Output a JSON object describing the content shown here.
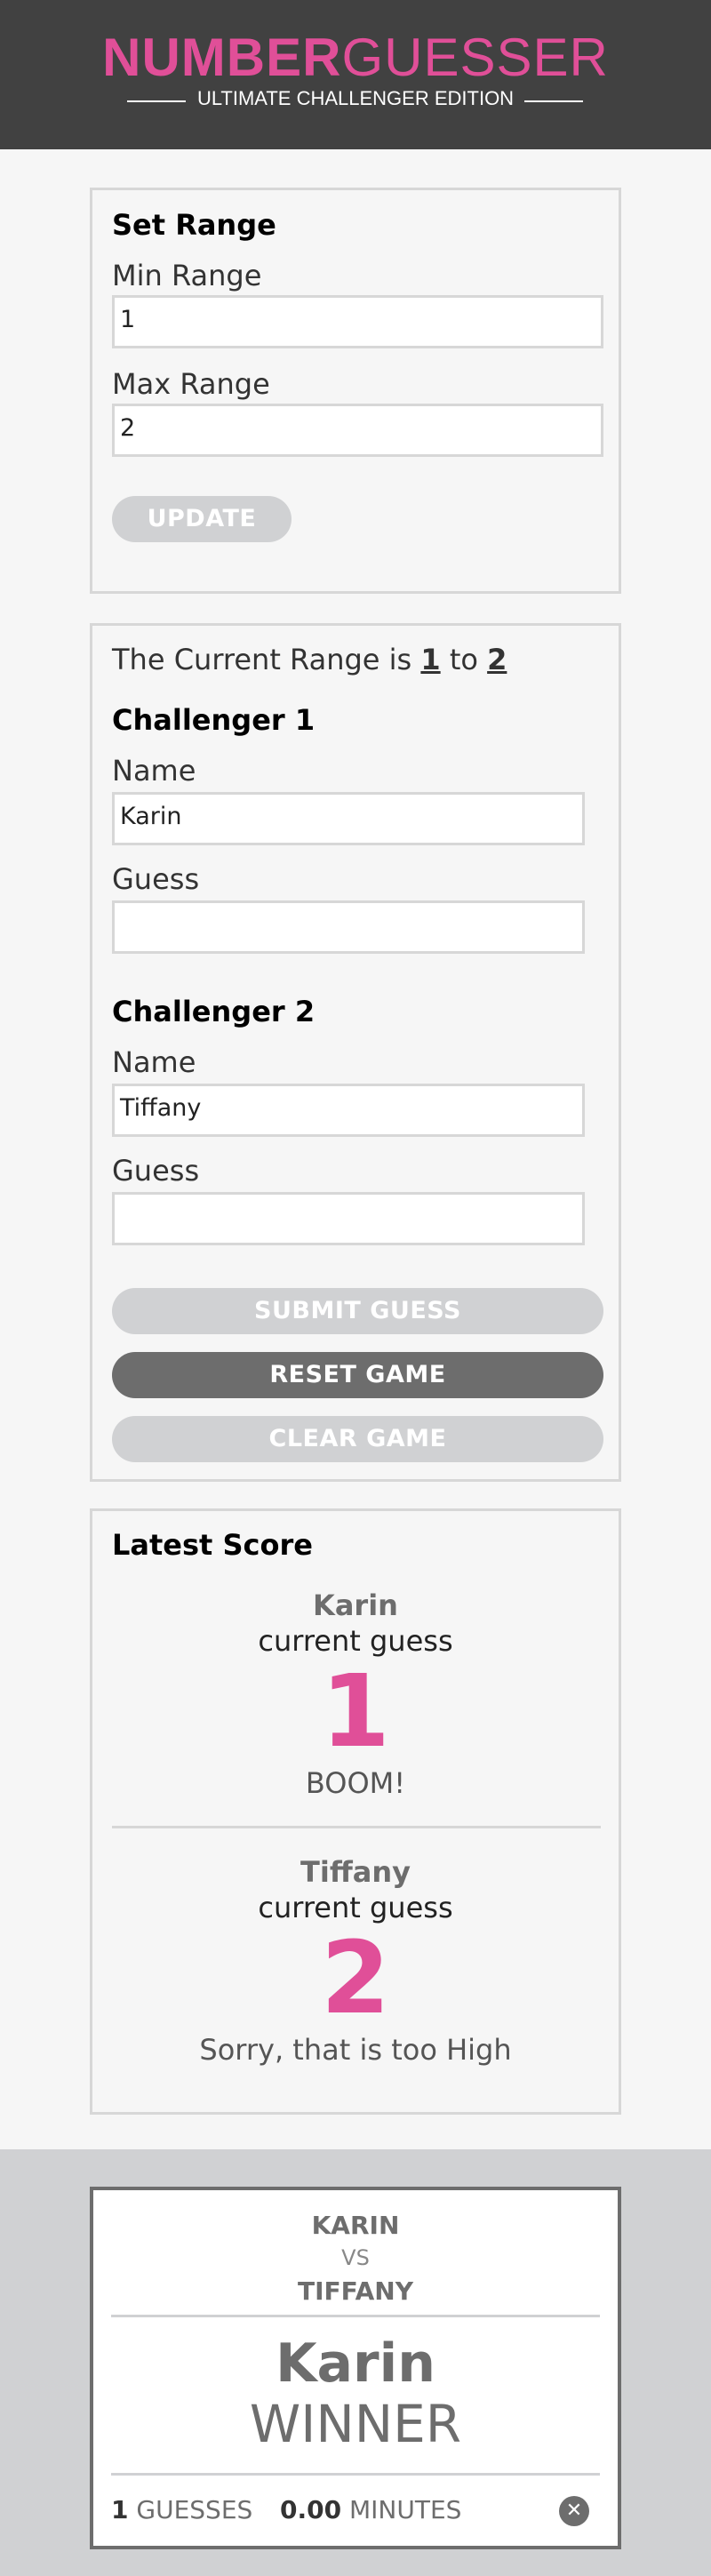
{
  "header": {
    "logo_bold": "NUMBER",
    "logo_light": "GUESSER",
    "subtitle": "ULTIMATE CHALLENGER EDITION"
  },
  "range_card": {
    "title": "Set Range",
    "min_label": "Min Range",
    "min_value": "1",
    "max_label": "Max Range",
    "max_value": "2",
    "update_label": "UPDATE"
  },
  "game_card": {
    "range_prefix": "The Current Range is",
    "range_min": "1",
    "range_to": "to",
    "range_max": "2",
    "challenger1": {
      "title": "Challenger 1",
      "name_label": "Name",
      "name_value": "Karin",
      "guess_label": "Guess",
      "guess_value": ""
    },
    "challenger2": {
      "title": "Challenger 2",
      "name_label": "Name",
      "name_value": "Tiffany",
      "guess_label": "Guess",
      "guess_value": ""
    },
    "submit_label": "SUBMIT GUESS",
    "reset_label": "RESET GAME",
    "clear_label": "CLEAR GAME"
  },
  "score_card": {
    "title": "Latest Score",
    "entries": [
      {
        "name": "Karin",
        "caption": "current guess",
        "guess": "1",
        "message": "BOOM!"
      },
      {
        "name": "Tiffany",
        "caption": "current guess",
        "guess": "2",
        "message": "Sorry, that is too High"
      }
    ]
  },
  "winner_card": {
    "player1": "KARIN",
    "vs": "VS",
    "player2": "TIFFANY",
    "winner_name": "Karin",
    "winner_label": "WINNER",
    "guesses_count": "1",
    "guesses_label": "GUESSES",
    "minutes_count": "0.00",
    "minutes_label": "MINUTES",
    "close_icon": "close-icon"
  },
  "colors": {
    "brand_pink": "#e04f98",
    "header_bg": "#414141",
    "dark_gray": "#6d6d6d",
    "light_gray": "#d0d1d3"
  }
}
